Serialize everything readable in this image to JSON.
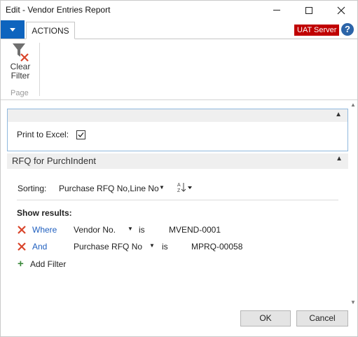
{
  "window": {
    "title": "Edit - Vendor Entries Report"
  },
  "ribbon": {
    "tab_actions": "ACTIONS",
    "server_badge": "UAT Server",
    "help_label": "?",
    "clear_filter_line1": "Clear",
    "clear_filter_line2": "Filter",
    "group_label": "Page"
  },
  "options": {
    "print_to_excel_label": "Print to Excel:",
    "print_to_excel_checked": true
  },
  "rfq_section": {
    "title": "RFQ for PurchIndent",
    "sorting_label": "Sorting:",
    "sorting_value": "Purchase RFQ No,Line No",
    "show_results_label": "Show results:",
    "filters": [
      {
        "conjunction": "Where",
        "field": "Vendor No.",
        "operator": "is",
        "value": "MVEND-0001"
      },
      {
        "conjunction": "And",
        "field": "Purchase RFQ No",
        "operator": "is",
        "value": "MPRQ-00058"
      }
    ],
    "add_filter_label": "Add Filter"
  },
  "buttons": {
    "ok": "OK",
    "cancel": "Cancel"
  },
  "colors": {
    "accent_blue": "#0e64be",
    "server_badge_red": "#c00000",
    "remove_filter_red": "#d9452b",
    "link_blue": "#1f5fbf",
    "add_green": "#3d8b3d",
    "panel_border": "#8fb8de"
  },
  "icons": {
    "file_menu": "chevron-down-icon",
    "clear_filter": "clear-filter-icon",
    "help": "help-icon",
    "sort_direction": "sort-az-icon",
    "remove_filter": "remove-filter-icon",
    "add": "plus-icon",
    "collapse": "chevron-up-icon"
  }
}
